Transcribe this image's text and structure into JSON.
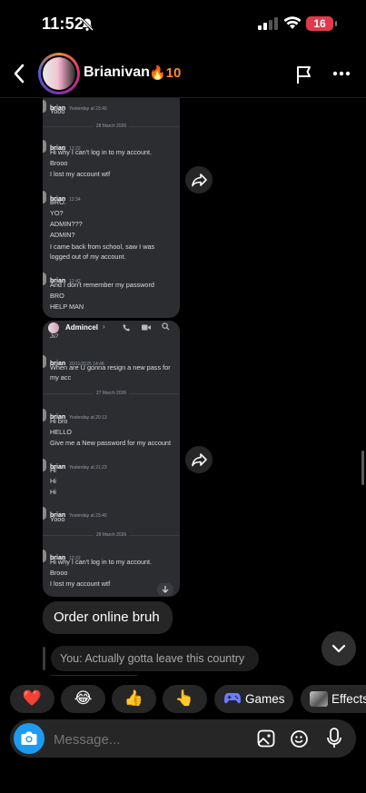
{
  "status_bar": {
    "time": "11:52",
    "battery": "16"
  },
  "header": {
    "name": "Brianivan",
    "streak": "🔥10"
  },
  "shot1": {
    "top_entry": {
      "user": "brian",
      "time": "Yesterday at 23:40",
      "text": "Yooo"
    },
    "date_divider": "28 March 2026",
    "groups": [
      {
        "user": "brian",
        "time": "12:22",
        "lines": [
          "Hi why I can't log in to my account.",
          "Brooo",
          "I lost my account wtf"
        ]
      },
      {
        "user": "brian",
        "time": "12:34",
        "lines": [
          "BRO.",
          "YO?",
          "ADMIN???",
          "ADMIN?",
          "I came back from school, saw I was",
          "logged out of my account."
        ]
      },
      {
        "user": "brian",
        "time": "12:42",
        "lines": [
          "And I don't remember my password",
          "BRO",
          "HELP MAN"
        ]
      }
    ]
  },
  "shot2": {
    "channel": "Admincel",
    "cut_text": "Js?",
    "groups": [
      {
        "user": "brian",
        "time": "20/11/2025 14:48",
        "lines": [
          "When are U gonna resign a new pass for",
          "my acc"
        ]
      },
      {
        "user": "brian",
        "time": "Yesterday at 20:13",
        "lines": [
          "Hi bro",
          "HELLO",
          "Give me a New password for my account"
        ]
      },
      {
        "user": "brian",
        "time": "Yesterday at 21:23",
        "lines": [
          "Hi",
          "Hi",
          "Hi"
        ]
      },
      {
        "user": "brian",
        "time": "Yesterday at 23:40",
        "lines": [
          "Yooo"
        ]
      },
      {
        "user": "brian",
        "time": "12:22",
        "lines": [
          "Hi why I can't log in to my account.",
          "Brooo",
          "I lost my account wtf"
        ]
      }
    ],
    "dividers": [
      "27 March 2026",
      "28 March 2026"
    ]
  },
  "messages": {
    "text_bubble": "Order online bruh",
    "reply_preview": "You: Actually gotta leave this country"
  },
  "reactions": [
    {
      "label": "❤️"
    },
    {
      "label": "😂"
    },
    {
      "label": "👍"
    },
    {
      "label": "👆"
    },
    {
      "label": "Games"
    },
    {
      "label": "Effects"
    }
  ],
  "composer": {
    "placeholder": "Message..."
  }
}
